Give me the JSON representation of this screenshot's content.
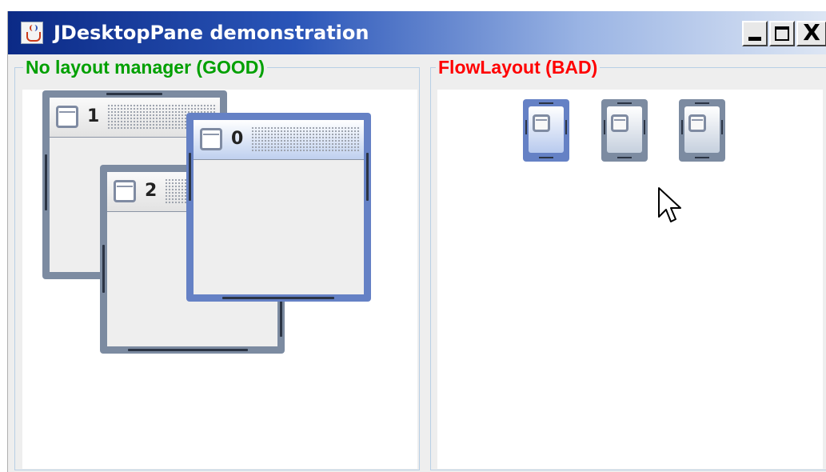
{
  "window": {
    "title": "JDesktopPane demonstration",
    "icon": "java-app-icon",
    "controls": {
      "minimize_icon": "minimize-icon",
      "maximize_icon": "maximize-icon",
      "close_label": "X"
    }
  },
  "panels": {
    "left": {
      "title": "No layout manager (GOOD)",
      "title_color": "#00a000",
      "frames": [
        {
          "label": "1",
          "active": false
        },
        {
          "label": "2",
          "active": false
        },
        {
          "label": "0",
          "active": true
        }
      ]
    },
    "right": {
      "title": "FlowLayout (BAD)",
      "title_color": "#ff0000",
      "icons": [
        {
          "icon": "window-icon",
          "active": true
        },
        {
          "icon": "window-icon",
          "active": false
        },
        {
          "icon": "window-icon",
          "active": false
        }
      ]
    }
  },
  "colors": {
    "title_bar_start": "#0b2a86",
    "active_frame": "#6581c5",
    "inactive_frame": "#7c8ba1"
  }
}
